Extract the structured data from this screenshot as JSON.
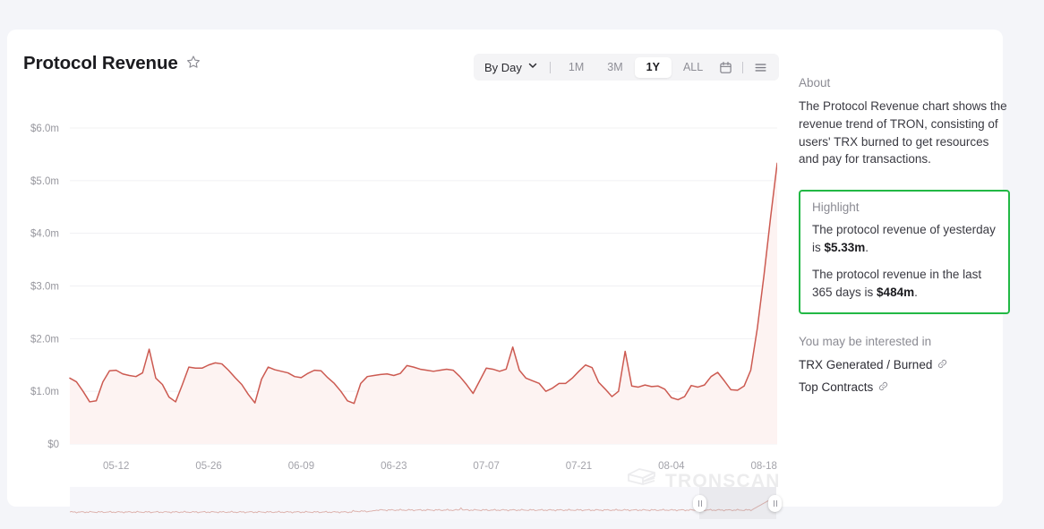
{
  "header": {
    "title": "Protocol Revenue",
    "favorite_icon": "star-icon"
  },
  "toolbar": {
    "granularity": "By Day",
    "chevron_icon": "chevron-down-icon",
    "ranges": [
      {
        "label": "1M",
        "active": false
      },
      {
        "label": "3M",
        "active": false
      },
      {
        "label": "1Y",
        "active": true
      },
      {
        "label": "ALL",
        "active": false
      }
    ],
    "calendar_icon": "calendar-icon",
    "menu_icon": "hamburger-menu-icon"
  },
  "watermark": {
    "text": "TRONSCAN",
    "logo_icon": "tronscan-logo-icon"
  },
  "brush": {
    "left_handle_icon": "brush-handle-left",
    "right_handle_icon": "brush-handle-right"
  },
  "sidebar": {
    "about_heading": "About",
    "about_text": "The Protocol Revenue chart shows the revenue trend of TRON, consisting of users' TRX burned to get resources and pay for transactions.",
    "highlight_heading": "Highlight",
    "highlight_border_color": "#22b845",
    "highlight_lines": [
      {
        "prefix": "The protocol revenue of yesterday is ",
        "value": "$5.33m",
        "suffix": "."
      },
      {
        "prefix": "The protocol revenue in the last 365 days is ",
        "value": "$484m",
        "suffix": "."
      }
    ],
    "interested_heading": "You may be interested in",
    "links": [
      {
        "label": "TRX Generated / Burned",
        "icon": "external-link-icon"
      },
      {
        "label": "Top Contracts",
        "icon": "external-link-icon"
      }
    ]
  },
  "chart_data": {
    "type": "line",
    "title": "Protocol Revenue",
    "xlabel": "",
    "ylabel": "",
    "line_color": "#cc5a51",
    "area_fill_color": "#fdf3f2",
    "grid": true,
    "legend": "none",
    "ylim": [
      0,
      6000000
    ],
    "yticks": [
      0,
      1000000,
      2000000,
      3000000,
      4000000,
      5000000,
      6000000
    ],
    "ytick_labels": [
      "$0",
      "$1.0m",
      "$2.0m",
      "$3.0m",
      "$4.0m",
      "$5.0m",
      "$6.0m"
    ],
    "xtick_labels": [
      "05-12",
      "05-26",
      "06-09",
      "06-23",
      "07-07",
      "07-21",
      "08-04",
      "08-18"
    ],
    "x": [
      "05-05",
      "05-06",
      "05-07",
      "05-08",
      "05-09",
      "05-10",
      "05-11",
      "05-12",
      "05-13",
      "05-14",
      "05-15",
      "05-16",
      "05-17",
      "05-18",
      "05-19",
      "05-20",
      "05-21",
      "05-22",
      "05-23",
      "05-24",
      "05-25",
      "05-26",
      "05-27",
      "05-28",
      "05-29",
      "05-30",
      "05-31",
      "06-01",
      "06-02",
      "06-03",
      "06-04",
      "06-05",
      "06-06",
      "06-07",
      "06-08",
      "06-09",
      "06-10",
      "06-11",
      "06-12",
      "06-13",
      "06-14",
      "06-15",
      "06-16",
      "06-17",
      "06-18",
      "06-19",
      "06-20",
      "06-21",
      "06-22",
      "06-23",
      "06-24",
      "06-25",
      "06-26",
      "06-27",
      "06-28",
      "06-29",
      "06-30",
      "07-01",
      "07-02",
      "07-03",
      "07-04",
      "07-05",
      "07-06",
      "07-07",
      "07-08",
      "07-09",
      "07-10",
      "07-11",
      "07-12",
      "07-13",
      "07-14",
      "07-15",
      "07-16",
      "07-17",
      "07-18",
      "07-19",
      "07-20",
      "07-21",
      "07-22",
      "07-23",
      "07-24",
      "07-25",
      "07-26",
      "07-27",
      "07-28",
      "07-29",
      "07-30",
      "07-31",
      "08-01",
      "08-02",
      "08-03",
      "08-04",
      "08-05",
      "08-06",
      "08-07",
      "08-08",
      "08-09",
      "08-10",
      "08-11",
      "08-12",
      "08-13",
      "08-14",
      "08-15",
      "08-16",
      "08-17",
      "08-18",
      "08-19",
      "08-20",
      "08-21",
      "08-22"
    ],
    "values": [
      1250000,
      1180000,
      1000000,
      800000,
      820000,
      1180000,
      1390000,
      1400000,
      1330000,
      1300000,
      1280000,
      1350000,
      1800000,
      1250000,
      1130000,
      890000,
      800000,
      1120000,
      1460000,
      1440000,
      1440000,
      1500000,
      1540000,
      1520000,
      1400000,
      1260000,
      1130000,
      940000,
      780000,
      1230000,
      1460000,
      1410000,
      1380000,
      1350000,
      1280000,
      1260000,
      1340000,
      1400000,
      1390000,
      1260000,
      1150000,
      1000000,
      820000,
      770000,
      1150000,
      1280000,
      1300000,
      1320000,
      1330000,
      1300000,
      1340000,
      1490000,
      1460000,
      1420000,
      1400000,
      1380000,
      1400000,
      1420000,
      1400000,
      1280000,
      1130000,
      960000,
      1200000,
      1440000,
      1420000,
      1380000,
      1420000,
      1840000,
      1400000,
      1250000,
      1200000,
      1150000,
      1000000,
      1060000,
      1150000,
      1150000,
      1250000,
      1380000,
      1500000,
      1450000,
      1170000,
      1040000,
      900000,
      1000000,
      1760000,
      1100000,
      1080000,
      1120000,
      1090000,
      1100000,
      1040000,
      880000,
      840000,
      900000,
      1110000,
      1080000,
      1120000,
      1280000,
      1360000,
      1200000,
      1030000,
      1020000,
      1100000,
      1400000,
      2200000,
      3200000,
      4300000,
      5330000
    ]
  }
}
